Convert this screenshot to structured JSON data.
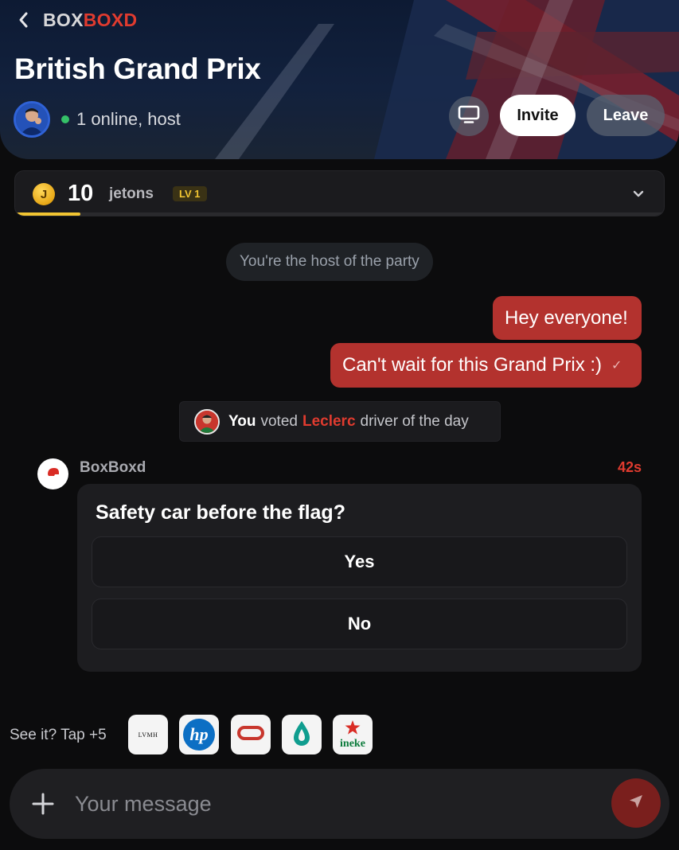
{
  "header": {
    "brand_part1": "BOX",
    "brand_part2": "BOXD",
    "title": "British Grand Prix",
    "online_status": "1 online, host",
    "invite_label": "Invite",
    "leave_label": "Leave"
  },
  "tokens": {
    "coin_letter": "J",
    "count": "10",
    "label": "jetons",
    "level": "LV 1",
    "progress_fraction": 0.1
  },
  "chat": {
    "system_message": "You're the host of the party",
    "messages": [
      {
        "text": "Hey everyone!"
      },
      {
        "text": "Can't wait for this Grand Prix :)",
        "status": "✓"
      }
    ],
    "vote": {
      "you": "You",
      "voted": "voted",
      "driver": "Leclerc",
      "rest": "driver of the day"
    },
    "poll": {
      "sender": "BoxBoxd",
      "timer": "42s",
      "question": "Safety car before the flag?",
      "options": [
        "Yes",
        "No"
      ]
    }
  },
  "sponsors": {
    "label": "See it? Tap +5",
    "logos": [
      {
        "text": "LVMH",
        "icon": "lvmh-logo"
      },
      {
        "text": "hp",
        "icon": "hp-logo"
      },
      {
        "text": "",
        "icon": "oracle-logo"
      },
      {
        "text": "",
        "icon": "petronas-logo"
      },
      {
        "text": "ineke",
        "icon": "heineken-logo"
      }
    ]
  },
  "composer": {
    "placeholder": "Your message"
  },
  "colors": {
    "accent_red": "#e03b2f",
    "bubble_red": "#b3322e",
    "online_green": "#35c168",
    "level_gold": "#f2c532"
  }
}
